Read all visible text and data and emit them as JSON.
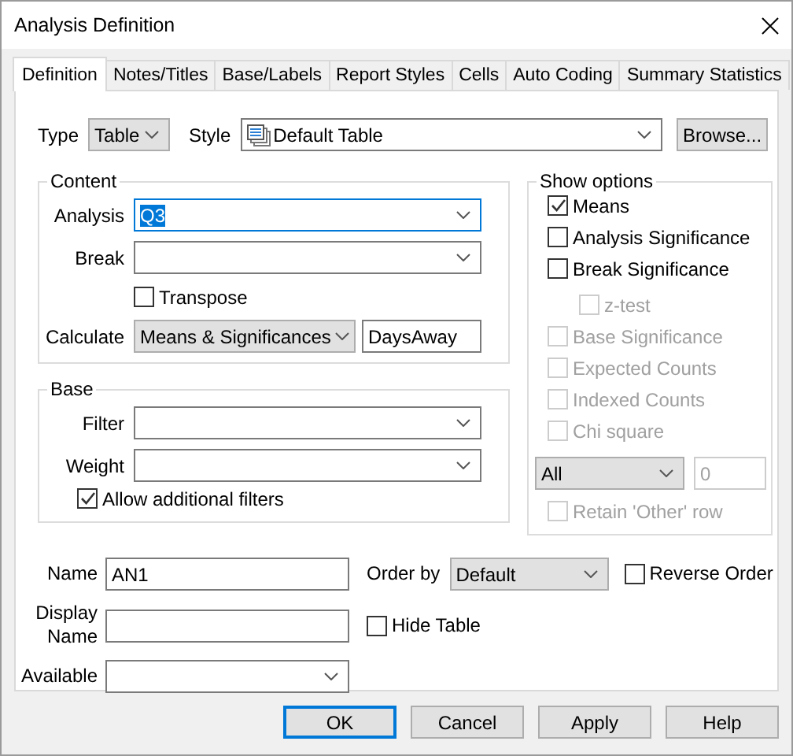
{
  "window": {
    "title": "Analysis Definition"
  },
  "tabs": [
    {
      "label": "Definition",
      "selected": true
    },
    {
      "label": "Notes/Titles",
      "selected": false
    },
    {
      "label": "Base/Labels",
      "selected": false
    },
    {
      "label": "Report Styles",
      "selected": false
    },
    {
      "label": "Cells",
      "selected": false
    },
    {
      "label": "Auto Coding",
      "selected": false
    },
    {
      "label": "Summary Statistics",
      "selected": false
    }
  ],
  "type": {
    "label": "Type",
    "value": "Table"
  },
  "style": {
    "label": "Style",
    "value": "Default Table"
  },
  "browse_button": "Browse...",
  "content": {
    "title": "Content",
    "analysis": {
      "label": "Analysis",
      "value": "Q3",
      "focused": true
    },
    "break": {
      "label": "Break"
    },
    "transpose": {
      "label": "Transpose",
      "checked": false
    },
    "calculate": {
      "label": "Calculate",
      "value": "Means & Significances",
      "field": "DaysAway"
    }
  },
  "base": {
    "title": "Base",
    "filter": {
      "label": "Filter"
    },
    "weight": {
      "label": "Weight"
    },
    "allow_filters": {
      "label": "Allow additional filters",
      "checked": true
    }
  },
  "show_options": {
    "title": "Show options",
    "options": [
      {
        "label": "Means",
        "checked": true,
        "disabled": false
      },
      {
        "label": "Analysis Significance",
        "checked": false,
        "disabled": false
      },
      {
        "label": "Break Significance",
        "checked": false,
        "disabled": false,
        "children": [
          {
            "label": "z-test",
            "checked": false,
            "disabled": true
          }
        ]
      },
      {
        "label": "Base Significance",
        "checked": false,
        "disabled": true
      },
      {
        "label": "Expected Counts",
        "checked": false,
        "disabled": true
      },
      {
        "label": "Indexed Counts",
        "checked": false,
        "disabled": true
      },
      {
        "label": "Chi square",
        "checked": false,
        "disabled": true
      }
    ],
    "limit": {
      "value": "All",
      "count": "0",
      "count_disabled": true
    },
    "retain": {
      "label": "Retain 'Other' row",
      "checked": false,
      "disabled": true
    }
  },
  "name": {
    "label": "Name",
    "value": "AN1"
  },
  "display_name": {
    "label": "Display Name"
  },
  "available": {
    "label": "Available"
  },
  "order_by": {
    "label": "Order by",
    "value": "Default"
  },
  "reverse_order": {
    "label": "Reverse Order",
    "checked": false
  },
  "hide_table": {
    "label": "Hide Table",
    "checked": false
  },
  "buttons": [
    {
      "label": "OK",
      "default": true
    },
    {
      "label": "Cancel",
      "default": false
    },
    {
      "label": "Apply",
      "default": false
    },
    {
      "label": "Help",
      "default": false
    }
  ]
}
